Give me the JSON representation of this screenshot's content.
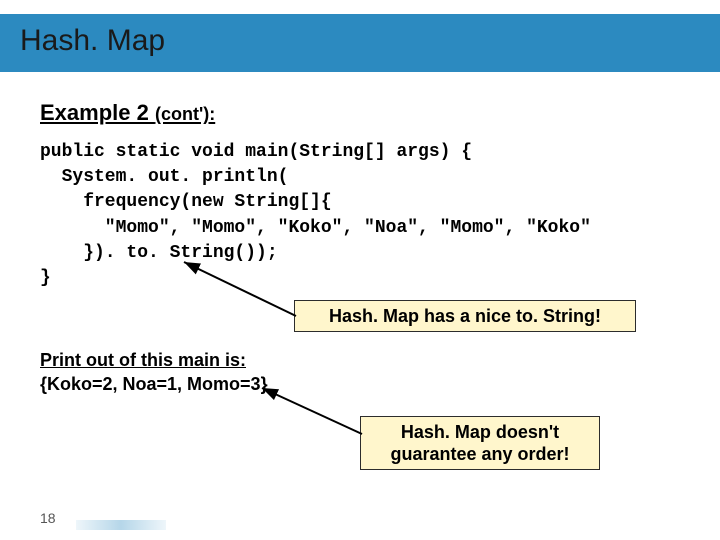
{
  "title": "Hash. Map",
  "subtitle_main": "Example 2 ",
  "subtitle_cont": "(cont'):",
  "code": "public static void main(String[] args) {\n  System. out. println(\n    frequency(new String[]{\n      \"Momo\", \"Momo\", \"Koko\", \"Noa\", \"Momo\", \"Koko\"\n    }). to. String());\n}",
  "callout1": "Hash. Map has a nice to. String!",
  "printout_label": "Print out of this main is:",
  "printout_value": "{Koko=2, Noa=1, Momo=3}",
  "callout2": "Hash. Map doesn't guarantee any order!",
  "page_number": "18"
}
